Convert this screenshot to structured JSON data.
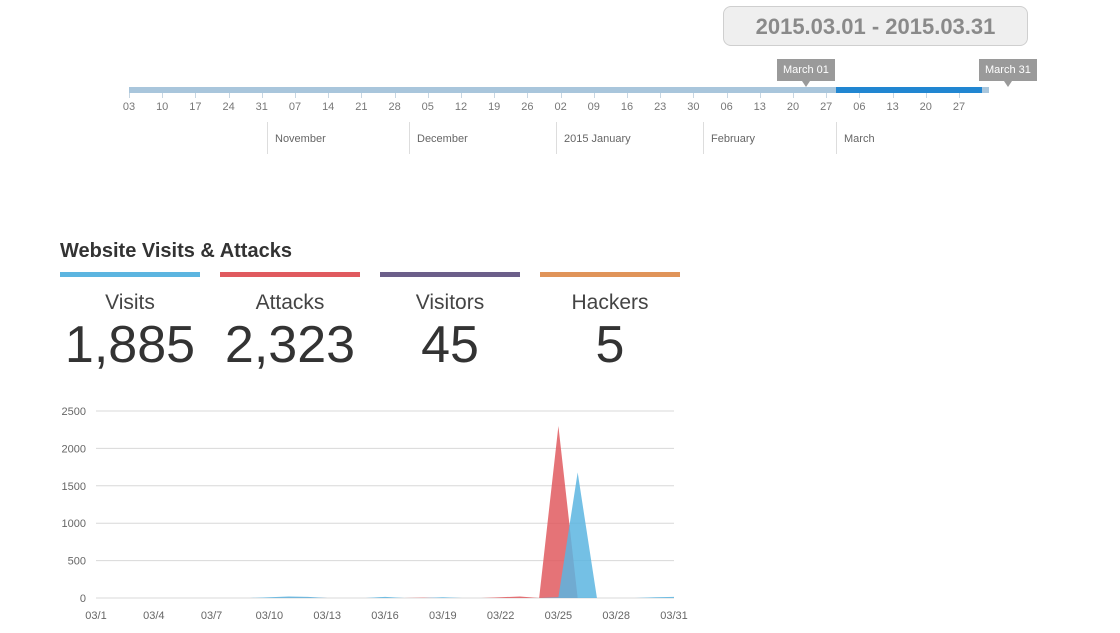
{
  "date_range": "2015.03.01 - 2015.03.31",
  "timeline": {
    "handle_start": "March 01",
    "handle_end": "March 31",
    "day_labels": [
      "03",
      "10",
      "17",
      "24",
      "31",
      "07",
      "14",
      "21",
      "28",
      "05",
      "12",
      "19",
      "26",
      "02",
      "09",
      "16",
      "23",
      "30",
      "06",
      "13",
      "20",
      "27",
      "06",
      "13",
      "20",
      "27"
    ],
    "months": [
      "November",
      "December",
      "2015 January",
      "February",
      "March"
    ],
    "colors": {
      "track": "#a9c6dc",
      "selected": "#2186d1"
    }
  },
  "section": {
    "title": "Website Visits & Attacks"
  },
  "stats": [
    {
      "label": "Visits",
      "value": "1,885",
      "color": "#5cb5e0"
    },
    {
      "label": "Attacks",
      "value": "2,323",
      "color": "#e05a5f"
    },
    {
      "label": "Visitors",
      "value": "45",
      "color": "#6c5f8a"
    },
    {
      "label": "Hackers",
      "value": "5",
      "color": "#e09459"
    }
  ],
  "chart_data": {
    "type": "area",
    "title": "",
    "xlabel": "",
    "ylabel": "",
    "ylim": [
      0,
      2500
    ],
    "yticks": [
      0,
      500,
      1000,
      1500,
      2000,
      2500
    ],
    "x": [
      "03/1",
      "03/2",
      "03/3",
      "03/4",
      "03/5",
      "03/6",
      "03/7",
      "03/8",
      "03/9",
      "03/10",
      "03/11",
      "03/12",
      "03/13",
      "03/14",
      "03/15",
      "03/16",
      "03/17",
      "03/18",
      "03/19",
      "03/20",
      "03/21",
      "03/22",
      "03/23",
      "03/24",
      "03/25",
      "03/26",
      "03/27",
      "03/28",
      "03/29",
      "03/30",
      "03/31"
    ],
    "x_tick_labels": [
      "03/1",
      "03/4",
      "03/7",
      "03/10",
      "03/13",
      "03/16",
      "03/19",
      "03/22",
      "03/25",
      "03/28",
      "03/31"
    ],
    "grid": true,
    "series": [
      {
        "color": "#e05a5f",
        "values": [
          0,
          0,
          0,
          0,
          0,
          0,
          0,
          0,
          0,
          0,
          5,
          5,
          0,
          0,
          0,
          0,
          0,
          5,
          0,
          0,
          0,
          10,
          20,
          0,
          2300,
          0,
          0,
          0,
          0,
          0,
          0
        ]
      },
      {
        "color": "#5cb5e0",
        "values": [
          0,
          0,
          0,
          0,
          0,
          0,
          0,
          0,
          0,
          10,
          20,
          15,
          0,
          0,
          0,
          15,
          0,
          0,
          10,
          0,
          0,
          0,
          0,
          0,
          10,
          1680,
          0,
          0,
          0,
          10,
          15
        ]
      }
    ]
  }
}
